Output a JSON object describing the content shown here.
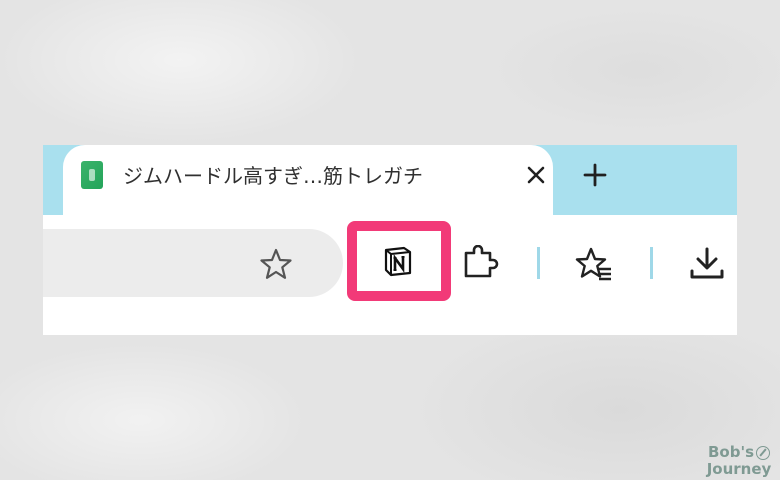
{
  "tab": {
    "title": "ジムハードル高すぎ…筋トレガチ",
    "close_icon": "close-icon",
    "favicon": "green-site-favicon"
  },
  "new_tab": {
    "label": "+"
  },
  "toolbar": {
    "bookmark_star_icon": "star-outline-icon",
    "notion_extension_icon": "notion-icon",
    "extensions_icon": "puzzle-piece-icon",
    "bookmarks_icon": "star-list-icon",
    "download_icon": "download-icon",
    "highlight_color": "#f23a78"
  },
  "colors": {
    "tabstrip": "#a9e0ee",
    "omnibox": "#ececec"
  },
  "brand": {
    "line1": "Bob's",
    "line2": "Journey"
  }
}
